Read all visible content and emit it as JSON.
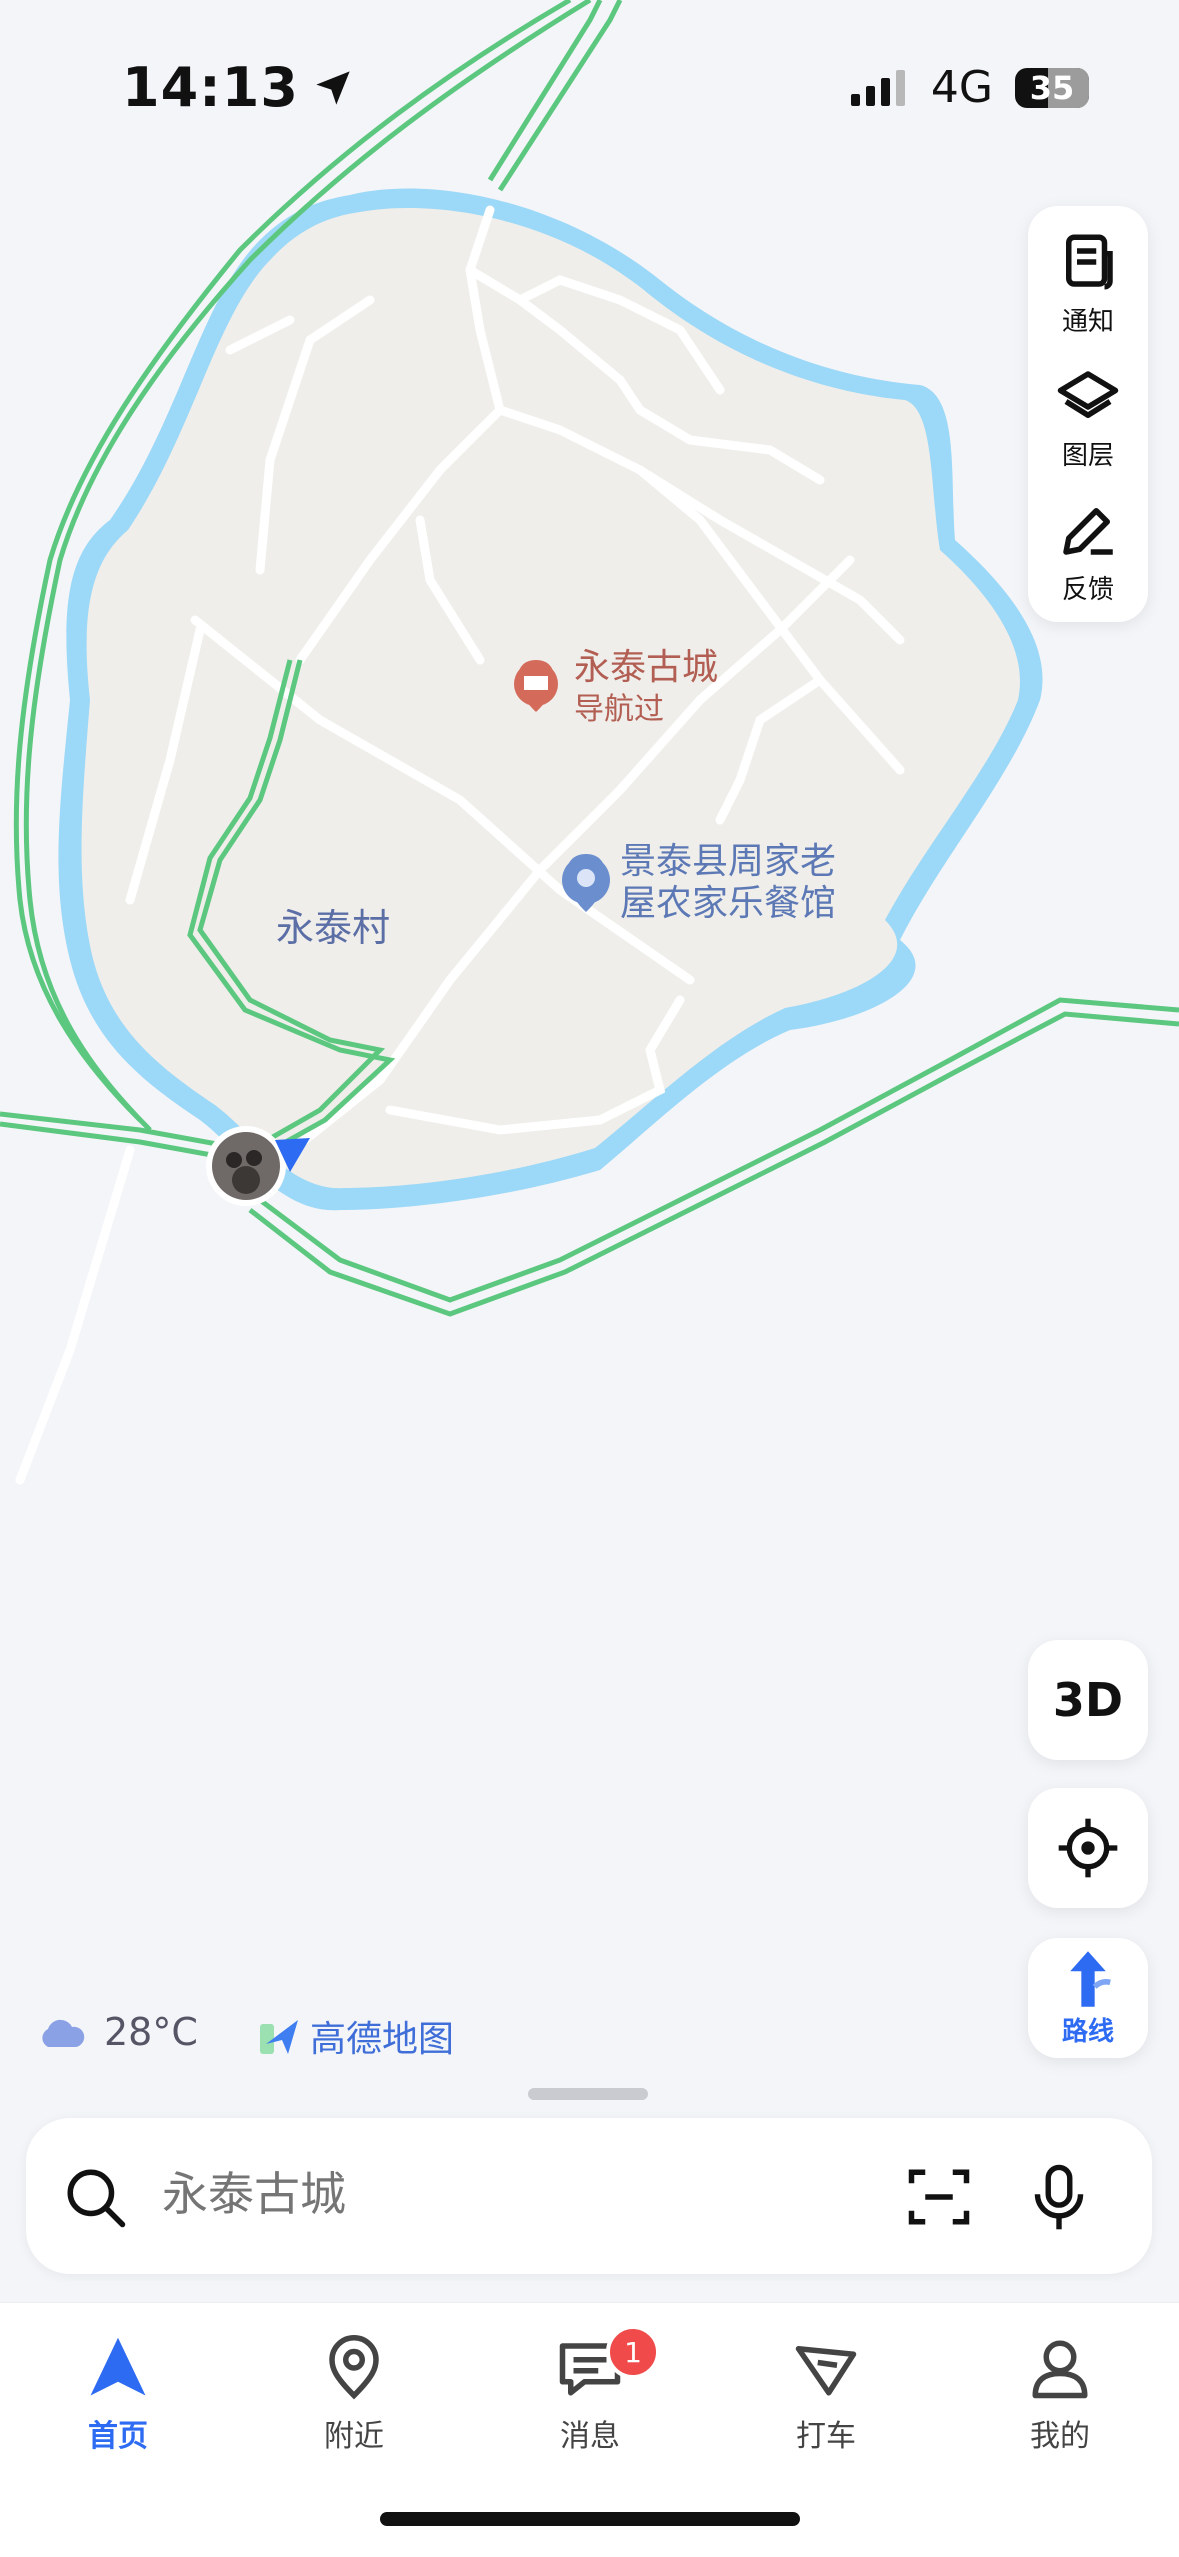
{
  "status_bar": {
    "time": "14:13",
    "network": "4G",
    "battery": "35"
  },
  "tools": {
    "notify": "通知",
    "layers": "图层",
    "feedback": "反馈"
  },
  "map": {
    "poi_ancient_city": {
      "name": "永泰古城",
      "sub": "导航过"
    },
    "poi_restaurant": {
      "line1": "景泰县周家老",
      "line2": "屋农家乐餐馆"
    },
    "village": "永泰村"
  },
  "controls": {
    "three_d": "3D",
    "route": "路线"
  },
  "weather": {
    "temp": "28°C"
  },
  "brand": "高德地图",
  "search": {
    "placeholder": "永泰古城"
  },
  "nav": {
    "home": "首页",
    "nearby": "附近",
    "messages": "消息",
    "messages_badge": "1",
    "taxi": "打车",
    "mine": "我的"
  },
  "colors": {
    "accent": "#2d6bf2",
    "water": "#9cd8f7",
    "land": "#efeeea",
    "road_green": "#5cc77f",
    "badge": "#f04a4a"
  }
}
